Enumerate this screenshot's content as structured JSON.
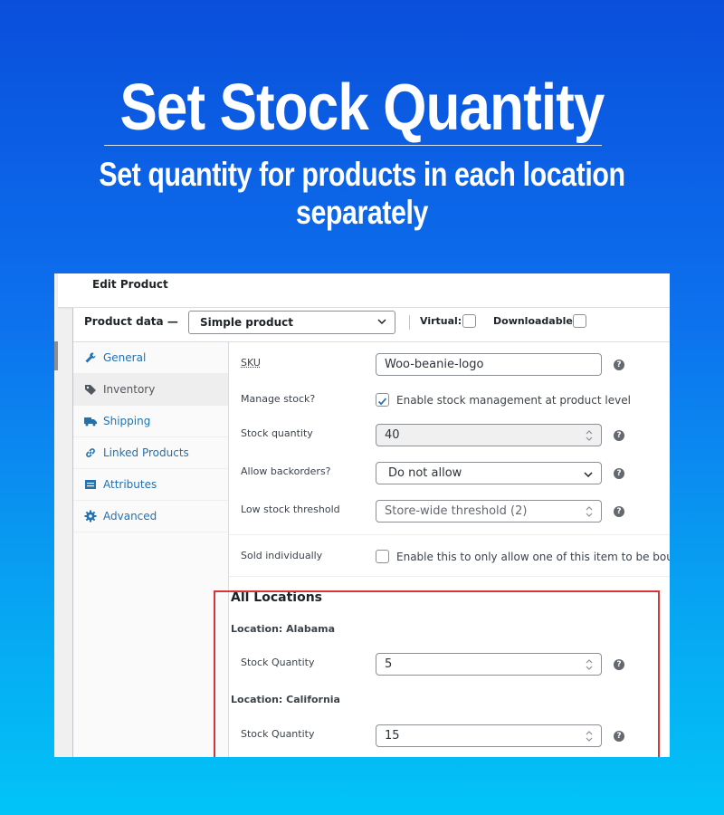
{
  "hero": {
    "title": "Set Stock Quantity",
    "subtitle": "Set quantity for products in each location separately"
  },
  "page": {
    "header_title": "Edit Product"
  },
  "product_data": {
    "label": "Product data —",
    "type_selected": "Simple product",
    "virtual_label": "Virtual:",
    "virtual_checked": false,
    "downloadable_label": "Downloadable:",
    "downloadable_checked": false
  },
  "tabs": [
    {
      "label": "General",
      "icon": "wrench-icon",
      "active": false
    },
    {
      "label": "Inventory",
      "icon": "tag-icon",
      "active": true
    },
    {
      "label": "Shipping",
      "icon": "truck-icon",
      "active": false
    },
    {
      "label": "Linked Products",
      "icon": "link-icon",
      "active": false
    },
    {
      "label": "Attributes",
      "icon": "list-icon",
      "active": false
    },
    {
      "label": "Advanced",
      "icon": "gear-icon",
      "active": false
    }
  ],
  "inventory": {
    "sku_label": "SKU",
    "sku_value": "Woo-beanie-logo",
    "manage_stock_label": "Manage stock?",
    "manage_stock_checked": true,
    "manage_stock_text": "Enable stock management at product level",
    "stock_qty_label": "Stock quantity",
    "stock_qty_value": "40",
    "backorders_label": "Allow backorders?",
    "backorders_value": "Do not allow",
    "low_stock_label": "Low stock threshold",
    "low_stock_placeholder": "Store-wide threshold (2)",
    "sold_individually_label": "Sold individually",
    "sold_individually_checked": false,
    "sold_individually_text": "Enable this to only allow one of this item to be bought in a single order"
  },
  "locations": {
    "section_title": "All Locations",
    "items": [
      {
        "title": "Location: Alabama",
        "field_label": "Stock Quantity",
        "value": "5"
      },
      {
        "title": "Location: California",
        "field_label": "Stock Quantity",
        "value": "15"
      }
    ]
  },
  "help_glyph": "?"
}
